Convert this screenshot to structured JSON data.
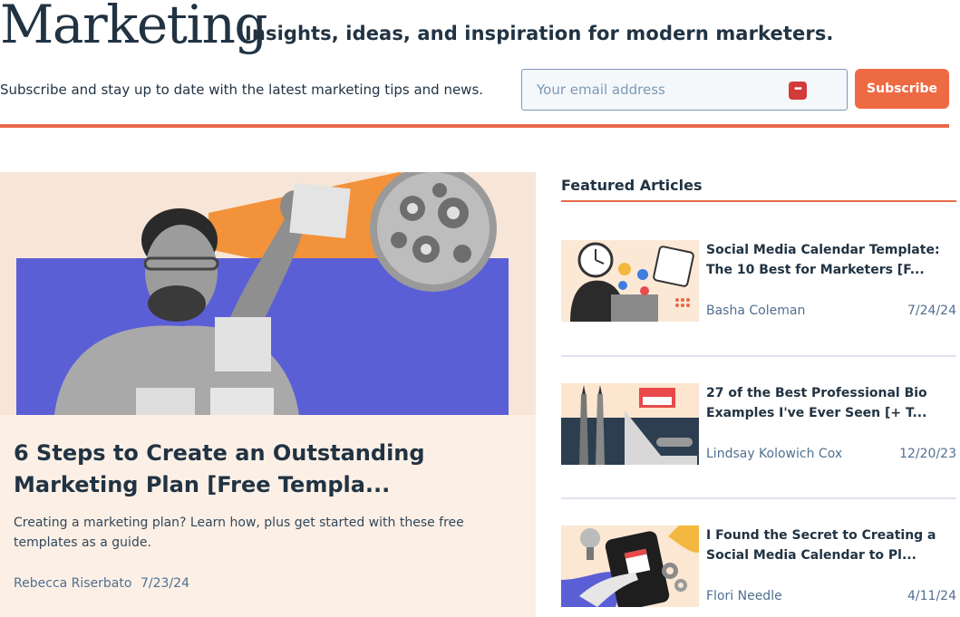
{
  "header": {
    "brand": "Marketing",
    "tagline": "Insights, ideas, and inspiration for modern marketers."
  },
  "subscribe": {
    "text": "Subscribe and stay up to date with the latest marketing tips and news.",
    "email_placeholder": "Your email address",
    "button_label": "Subscribe",
    "password_icon": "•••"
  },
  "hero": {
    "image_icon": "marketer-sticky-notes-image",
    "title": "6 Steps to Create an Outstanding Marketing Plan [Free Templa...",
    "description": "Creating a marketing plan? Learn how, plus get started with these free templates as a guide.",
    "author": "Rebecca Riserbato",
    "date": "7/23/24"
  },
  "featured": {
    "heading": "Featured Articles",
    "articles": [
      {
        "title": "Social Media Calendar Template: The 10 Best for Marketers [F...",
        "author": "Basha Coleman",
        "date": "7/24/24",
        "image_icon": "clock-calendar-laptop-image"
      },
      {
        "title": "27 of the Best Professional Bio Examples I've Ever Seen [+ T...",
        "author": "Lindsay Kolowich Cox",
        "date": "12/20/23",
        "image_icon": "fountain-pens-laptop-image"
      },
      {
        "title": "I Found the Secret to Creating a Social Media Calendar to Pl...",
        "author": "Flori Needle",
        "date": "4/11/24",
        "image_icon": "phone-calendar-gears-image"
      }
    ]
  },
  "colors": {
    "accent": "#ee6a43",
    "text": "#213343",
    "muted": "#516f90",
    "hero_bg": "#fcf0e6",
    "hero_purple": "#5b5fd6",
    "hero_orange": "#f2923a"
  }
}
